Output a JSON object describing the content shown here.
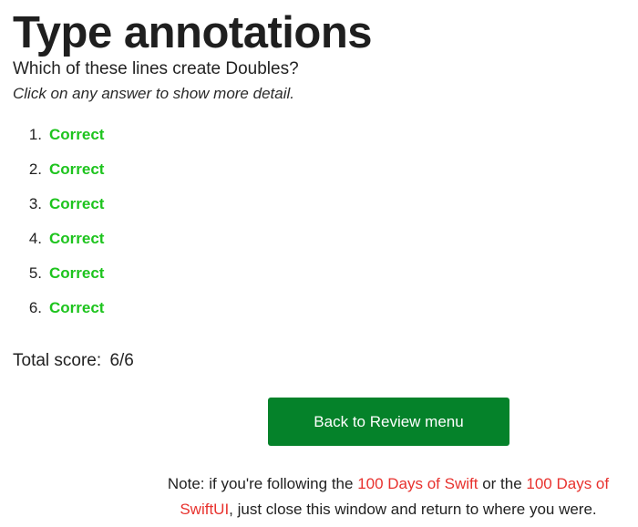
{
  "page": {
    "title": "Type annotations",
    "question": "Which of these lines create Doubles?",
    "hint": "Click on any answer to show more detail."
  },
  "answers": [
    {
      "number": "1.",
      "status": "Correct"
    },
    {
      "number": "2.",
      "status": "Correct"
    },
    {
      "number": "3.",
      "status": "Correct"
    },
    {
      "number": "4.",
      "status": "Correct"
    },
    {
      "number": "5.",
      "status": "Correct"
    },
    {
      "number": "6.",
      "status": "Correct"
    }
  ],
  "score": {
    "label": "Total score:",
    "value": "6/6"
  },
  "back_button": {
    "label": "Back to Review menu"
  },
  "note": {
    "prefix": "Note: if you're following the ",
    "link1": "100 Days of Swift",
    "middle": " or the ",
    "link2": "100 Days of SwiftUI",
    "suffix": ", just close this window and return to where you were."
  },
  "colors": {
    "correct": "#1ec41e",
    "button_bg": "#05822a",
    "link": "#e8322e"
  }
}
